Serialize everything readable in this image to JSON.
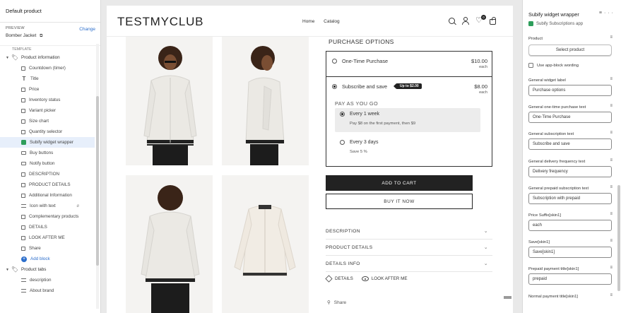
{
  "sidebar": {
    "header": "Default product",
    "preview_label": "PREVIEW",
    "change": "Change",
    "preview_value": "Bomber Jacket",
    "template_label": "TEMPLATE",
    "product_information": "Product information",
    "blocks": [
      {
        "label": "Countdown (timer)",
        "icon": "bracket-icon"
      },
      {
        "label": "Title",
        "icon": "text-icon"
      },
      {
        "label": "Price",
        "icon": "bracket-icon"
      },
      {
        "label": "Inventory status",
        "icon": "bracket-icon"
      },
      {
        "label": "Variant picker",
        "icon": "bracket-icon"
      },
      {
        "label": "Size chart",
        "icon": "bracket-icon"
      },
      {
        "label": "Quantity selector",
        "icon": "bracket-icon"
      },
      {
        "label": "Subify widget wrapper",
        "icon": "app-icon"
      },
      {
        "label": "Buy buttons",
        "icon": "button-icon"
      },
      {
        "label": "Notify button",
        "icon": "button-icon"
      },
      {
        "label": "DESCRIPTION",
        "icon": "bracket-icon"
      },
      {
        "label": "PRODUCT DETAILS",
        "icon": "bracket-icon"
      },
      {
        "label": "Additional Information",
        "icon": "bracket-icon"
      },
      {
        "label": "Icon with text",
        "icon": "lines-icon"
      },
      {
        "label": "Complementary products",
        "icon": "bracket-icon"
      },
      {
        "label": "DETAILS",
        "icon": "bracket-icon"
      },
      {
        "label": "LOOK AFTER ME",
        "icon": "bracket-icon"
      },
      {
        "label": "Share",
        "icon": "bracket-icon"
      }
    ],
    "add_block": "Add block",
    "product_tabs": "Product tabs",
    "tab_blocks": [
      {
        "label": "description",
        "icon": "lines-icon"
      },
      {
        "label": "About brand",
        "icon": "lines-icon"
      }
    ]
  },
  "store": {
    "logo": "TESTMYCLUB",
    "nav": [
      "Home",
      "Catalog"
    ],
    "wishlist_count": "0"
  },
  "purchase": {
    "title": "PURCHASE OPTIONS",
    "one_time_label": "One-Time Purchase",
    "one_time_price": "$10.00",
    "one_time_each": "each",
    "subscribe_label": "Subscribe and save",
    "subscribe_badge": "Up to $2.00",
    "subscribe_price": "$8.00",
    "subscribe_each": "each",
    "payg": "PAY AS YOU GO",
    "freq1_name": "Every 1 week",
    "freq1_sub": "Pay $8 on the first payment, then $9",
    "freq2_name": "Every 3 days",
    "freq2_sub": "Save 5 %",
    "add_to_cart": "ADD TO CART",
    "buy_now": "BUY IT NOW",
    "accordions": [
      "DESCRIPTION",
      "PRODUCT DETAILS",
      "DETAILS INFO"
    ],
    "tab_details": "DETAILS",
    "tab_look": "LOOK AFTER ME",
    "share": "Share"
  },
  "settings": {
    "title": "Subify widget wrapper",
    "app": "Subify Subscriptions app",
    "product_label": "Product",
    "select_product": "Select product",
    "use_app_block": "Use app-block wording",
    "fields": [
      {
        "label": "General widget label",
        "value": "Purchase options"
      },
      {
        "label": "General one-time purchase text",
        "value": "One-Time Purchase"
      },
      {
        "label": "General subscription text",
        "value": "Subscribe and save"
      },
      {
        "label": "General delivery frequency text",
        "value": "Delivery frequency"
      },
      {
        "label": "General prepaid subscription text",
        "value": "Subscription with prepaid"
      },
      {
        "label": "Price Suffix[skin1]",
        "value": "each"
      },
      {
        "label": "Save[skin1]",
        "value": "Save[skin1]"
      },
      {
        "label": "Prepaid payment title[skin1]",
        "value": "prepaid"
      },
      {
        "label": "Normal payment title[skin1]",
        "value": ""
      }
    ]
  },
  "colors": {
    "accent": "#2c6ecb",
    "app_green": "#2e9e5b",
    "dark_button": "#222222"
  }
}
